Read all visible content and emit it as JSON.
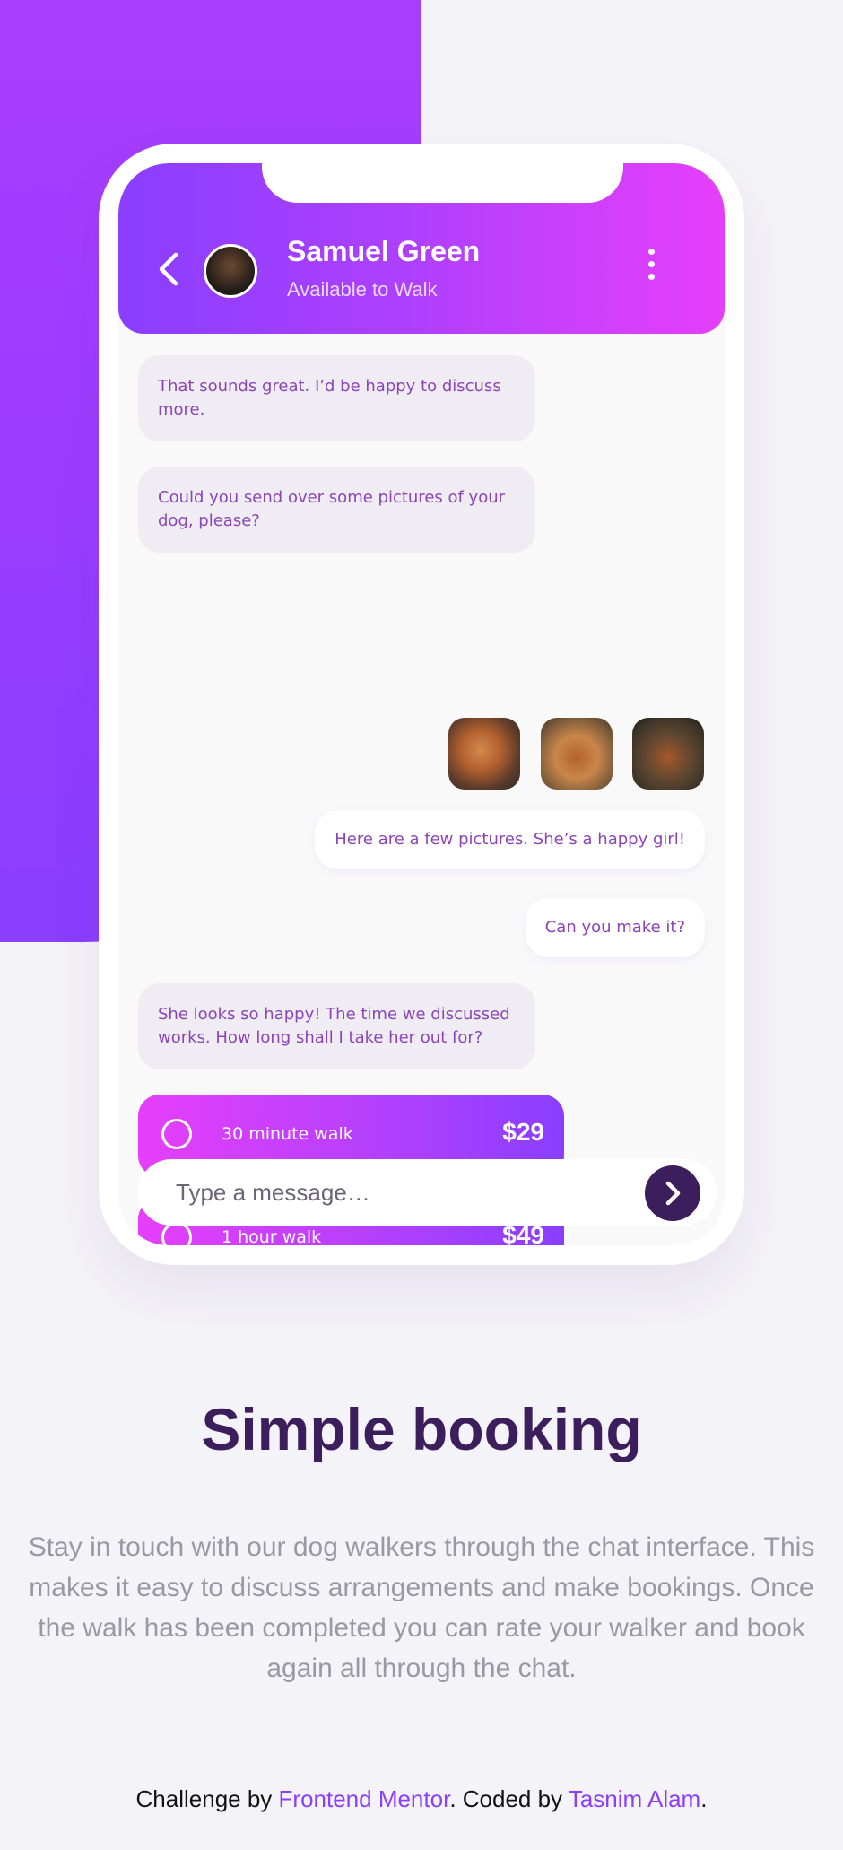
{
  "chat": {
    "contact_name": "Samuel Green",
    "contact_status": "Available to Walk",
    "messages": [
      {
        "from": "walker",
        "text": "That sounds great. I’d be happy to discuss more."
      },
      {
        "from": "walker",
        "text": "Could you send over some pictures of your dog, please?"
      },
      {
        "from": "owner",
        "text": "Here are a few pictures. She’s a happy girl!"
      },
      {
        "from": "owner",
        "text": "Can you make it?"
      },
      {
        "from": "walker",
        "text": "She looks so happy! The time we discussed works. How long shall I take her out for?"
      }
    ],
    "options": [
      {
        "label": "30 minute walk",
        "price": "$29"
      },
      {
        "label": "1 hour walk",
        "price": "$49"
      }
    ],
    "input_placeholder": "Type a message…"
  },
  "section": {
    "title": "Simple booking",
    "body": "Stay in touch with our dog walkers through the chat interface. This makes it easy to discuss arrangements and make bookings. Once the walk has been completed you can rate your walker and book again all through the chat."
  },
  "footer": {
    "prefix": "Challenge by ",
    "link1": "Frontend Mentor",
    "middle": ". Coded by ",
    "link2": "Tasnim Alam",
    "suffix": "."
  },
  "colors": {
    "primary_purple": "#8a3efe",
    "magenta": "#e63ffb",
    "dark_purple": "#3d1e5c",
    "bubble_text": "#8c45b8",
    "muted_text": "#9a99a3"
  },
  "icons": [
    "chevron-left-icon",
    "more-vertical-icon",
    "chevron-right-icon"
  ]
}
